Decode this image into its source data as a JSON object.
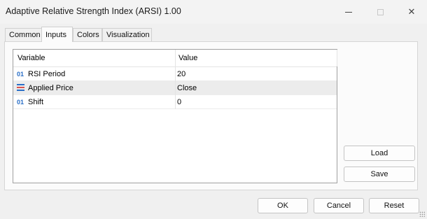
{
  "window": {
    "title": "Adaptive Relative Strength Index (ARSI) 1.00"
  },
  "titlebar_buttons": {
    "minimize": "minimize-icon",
    "maximize": "maximize-icon",
    "close": "close-icon",
    "close_glyph": "✕"
  },
  "tabs": [
    {
      "label": "Common",
      "active": false
    },
    {
      "label": "Inputs",
      "active": true
    },
    {
      "label": "Colors",
      "active": false
    },
    {
      "label": "Visualization",
      "active": false
    }
  ],
  "grid": {
    "columns": [
      "Variable",
      "Value"
    ],
    "rows": [
      {
        "icon": "integer-type-icon",
        "icon_text": "01",
        "variable": "RSI Period",
        "value": "20",
        "selected": false
      },
      {
        "icon": "enum-type-icon",
        "icon_text": "",
        "variable": "Applied Price",
        "value": "Close",
        "selected": true
      },
      {
        "icon": "integer-type-icon",
        "icon_text": "01",
        "variable": "Shift",
        "value": "0",
        "selected": false
      }
    ]
  },
  "side_buttons": {
    "load": "Load",
    "save": "Save"
  },
  "footer_buttons": {
    "ok": "OK",
    "cancel": "Cancel",
    "reset": "Reset"
  },
  "colors": {
    "icon_blue": "#2a6fc7",
    "selected_row": "#ececec"
  }
}
